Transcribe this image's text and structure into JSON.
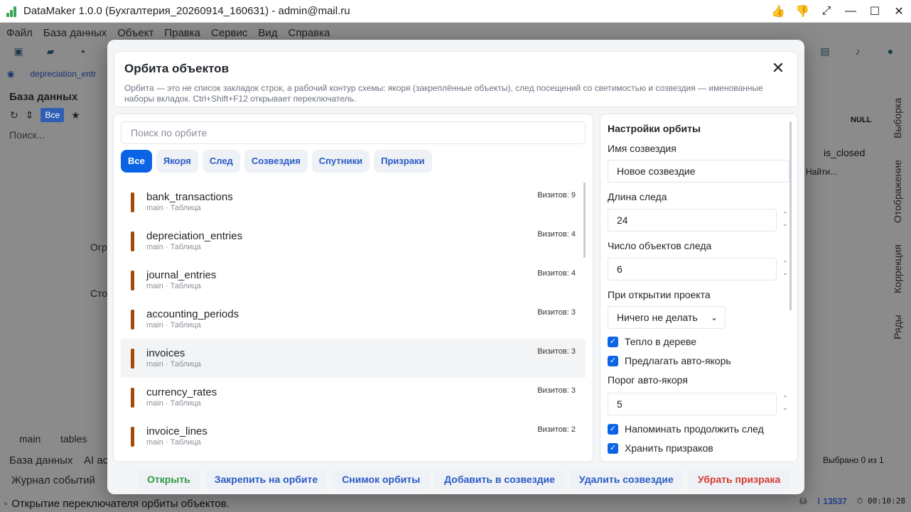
{
  "window": {
    "title": "DataMaker 1.0.0 (Бухгалтерия_20260914_160631) - admin@mail.ru",
    "controls": [
      "thumbs-up-icon",
      "thumbs-down-icon",
      "fullscreen-icon",
      "minimize-icon",
      "maximize-icon",
      "close-icon"
    ]
  },
  "menu": [
    "Файл",
    "База данных",
    "Объект",
    "Правка",
    "Сервис",
    "Вид",
    "Справка"
  ],
  "tab_strip": {
    "active_tab": "depreciation_entr"
  },
  "left_panel": {
    "title": "База данных",
    "all_label": "Все",
    "search_placeholder": "Поиск...",
    "tree_group_1": "Огр",
    "tree_group_2": "Сто",
    "breadcrumb_main": "main",
    "breadcrumb_tables": "tables",
    "bottom_tabs": [
      "База данных",
      "AI ас"
    ],
    "event_log": "Журнал событий"
  },
  "right_panel": {
    "null_label": "NULL",
    "is_closed": "is_closed",
    "find_placeholder": "Найти...",
    "vertical_tabs": [
      "Выборка",
      "Отображение",
      "Коррекция",
      "Ряды"
    ],
    "selected_status": "Выбрано 0 из 1"
  },
  "status_bar": {
    "message": "Открытие переключателя орбиты объектов.",
    "count": "13537",
    "timer": "00:10:28"
  },
  "modal": {
    "title": "Орбита объектов",
    "description": "Орбита — это не список закладок строк, а рабочий контур схемы: якоря (закреплённые объекты), след посещений со светимостью и созвездия — именованные наборы вкладок. Ctrl+Shift+F12 открывает переключатель.",
    "search_placeholder": "Поиск по орбите",
    "filters": [
      {
        "label": "Все",
        "active": true
      },
      {
        "label": "Якоря",
        "active": false
      },
      {
        "label": "След",
        "active": false
      },
      {
        "label": "Созвездия",
        "active": false
      },
      {
        "label": "Спутники",
        "active": false
      },
      {
        "label": "Призраки",
        "active": false
      }
    ],
    "items": [
      {
        "name": "bank_transactions",
        "meta": "main · Таблица",
        "visits": "Визитов: 9",
        "selected": false
      },
      {
        "name": "depreciation_entries",
        "meta": "main · Таблица",
        "visits": "Визитов: 4",
        "selected": false
      },
      {
        "name": "journal_entries",
        "meta": "main · Таблица",
        "visits": "Визитов: 4",
        "selected": false
      },
      {
        "name": "accounting_periods",
        "meta": "main · Таблица",
        "visits": "Визитов: 3",
        "selected": false
      },
      {
        "name": "invoices",
        "meta": "main · Таблица",
        "visits": "Визитов: 3",
        "selected": true
      },
      {
        "name": "currency_rates",
        "meta": "main · Таблица",
        "visits": "Визитов: 3",
        "selected": false
      },
      {
        "name": "invoice_lines",
        "meta": "main · Таблица",
        "visits": "Визитов: 2",
        "selected": false
      }
    ],
    "settings": {
      "title": "Настройки орбиты",
      "constellation_name_label": "Имя созвездия",
      "constellation_name_value": "Новое созвездие",
      "trail_length_label": "Длина следа",
      "trail_length_value": "24",
      "trail_objects_label": "Число объектов следа",
      "trail_objects_value": "6",
      "on_open_label": "При открытии проекта",
      "on_open_value": "Ничего не делать",
      "warm_tree_label": "Тепло в дереве",
      "suggest_anchor_label": "Предлагать авто-якорь",
      "anchor_threshold_label": "Порог авто-якоря",
      "anchor_threshold_value": "5",
      "remind_trail_label": "Напоминать продолжить след",
      "keep_ghosts_label": "Хранить призраков"
    },
    "buttons": {
      "open": "Открыть",
      "pin": "Закрепить на орбите",
      "snapshot": "Снимок орбиты",
      "add_constellation": "Добавить в созвездие",
      "delete_constellation": "Удалить созвездие",
      "remove_ghost": "Убрать призрака"
    }
  }
}
